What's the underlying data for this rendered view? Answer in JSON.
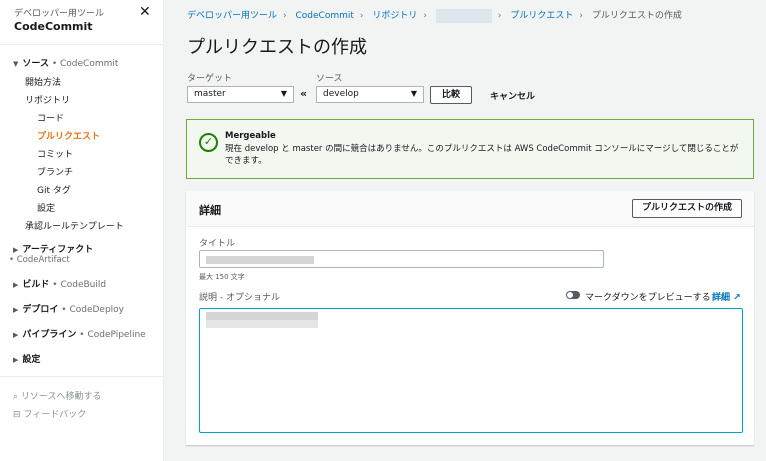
{
  "sidebar": {
    "supertitle": "デベロッパー用ツール",
    "title": "CodeCommit",
    "source": {
      "label": "ソース",
      "service": "• CodeCommit"
    },
    "items": [
      "開始方法",
      "リポジトリ",
      "コード",
      "プルリクエスト",
      "コミット",
      "ブランチ",
      "Git タグ",
      "設定",
      "承認ルールテンプレート"
    ],
    "groups": [
      {
        "label": "アーティファクト",
        "service": "• CodeArtifact"
      },
      {
        "label": "ビルド",
        "service": "• CodeBuild"
      },
      {
        "label": "デプロイ",
        "service": "• CodeDeploy"
      },
      {
        "label": "パイプライン",
        "service": "• CodePipeline"
      },
      {
        "label": "設定",
        "service": ""
      }
    ],
    "footer": [
      "リソースへ移動する",
      "フィードバック"
    ]
  },
  "breadcrumb": [
    "デベロッパー用ツール",
    "CodeCommit",
    "リポジトリ",
    "プルリクエスト",
    "プルリクエストの作成"
  ],
  "page_title": "プルリクエストの作成",
  "compare": {
    "target_label": "ターゲット",
    "target_value": "master",
    "source_label": "ソース",
    "source_value": "develop",
    "compare_button": "比較",
    "cancel": "キャンセル"
  },
  "alert": {
    "title": "Mergeable",
    "message": "現在 develop と master の間に競合はありません。このプルリクエストは AWS CodeCommit コンソールにマージして閉じることができます。"
  },
  "details": {
    "heading": "詳細",
    "create_button": "プルリクエストの作成",
    "title_label": "タイトル",
    "title_hint": "最大 150 文字",
    "desc_label": "説明 - オプショナル",
    "preview_toggle": "マークダウンをプレビューする",
    "learn_more": "詳細"
  }
}
